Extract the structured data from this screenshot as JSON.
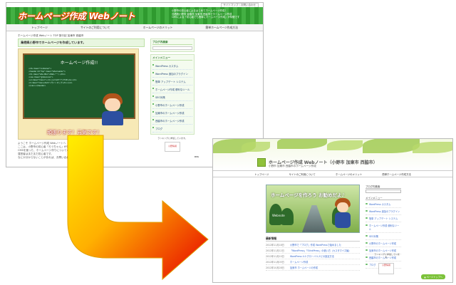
{
  "old": {
    "topbar_link": "サイトマップ｜お問い合わせ",
    "logo": "ホームページ作成 Webノート",
    "header_info": [
      "小野市の初心者によるはじめてホームページ作成！",
      "鳥栖県小野市 姫路市 加東市 西脇市でホームページ作成",
      "CMSによる「初心者でも簡単にホームページ作成」が特徴です"
    ],
    "nav": [
      "トップページ",
      "サイトのご利用について",
      "ホームページのメリット",
      "簡単ホームページ作成方法"
    ],
    "breadcrumb": "ホームページ作成 Webノート TOP 旅行記 加東市 西脇市",
    "main_title": "鳥栖県小野市でホームページを作成しています。",
    "board_title": "ホームページ作成!!",
    "board_code": [
      "<div class=\"container\">",
      "<header id=\"top\" class=\"site-header\">",
      "<h1 class=\"site-title\">Webノート</h1>",
      "<nav class=\"global-nav\">",
      "<ul class=\"menu\"><li><a href=\"/\">TOP</a></li>",
      "<li class=\"menu-item\">サイトマップ</li></ul>",
      "</nav></header>"
    ],
    "slogan": "頑張ります！元気です！",
    "paragraph": [
      "ようこそ ホームページ作成 Webノートへ",
      "ここは、小野市の初心者「ろうちゃん」が作成したホームページです。",
      "CMSを使った、ホームページ作りについての記事などを掲載しています。",
      "運営者はまだまだ初心者です。",
      "なにか分からないことがあれば、お問い合わせからお気軽にどうぞ"
    ],
    "sidebar_search_label": "ブログ内検索",
    "sidebar_menu_head": "メインメニュー",
    "sidebar_items": [
      "WordPress カスタム",
      "WordPress 追加のプラグイン",
      "簡単 アップデート システム",
      "ホームページ作成 便利なツール",
      "SEO対策",
      "小野市のホームページ作成",
      "加東市のホームページ作成",
      "西脇市のホームページ作成",
      "ブログ"
    ],
    "side_note": "ランキングに参加しています。",
    "side_badge": "小野情報",
    "rss": "RSS"
  },
  "new": {
    "site_title": "ホームページ作成 Webノート（小野市 加東市 西脇市）",
    "site_sub": "小野市 加東市 西脇市のホームページ作成",
    "nav": [
      "トップページ",
      "サイトのご利用について",
      "ホームページのメリット",
      "簡単ホームページ作成方法"
    ],
    "banner_title": "ホームページを作ろう お勧めだよ♪",
    "banner_badge": "Webnote",
    "section_title": "最新情報",
    "posts": [
      {
        "date": "2012年11月18日",
        "title": "小野市で「ブログ」作成 WordPressで始めました"
      },
      {
        "date": "2012年11月12日",
        "title": "「WordPress」「StinkPress」の使い方（カスタマイズ編）"
      },
      {
        "date": "2012年11月10日",
        "title": "WordPress 4.0 グローバルナビの設定方法"
      },
      {
        "date": "2012年11月05日",
        "title": "ホームページ作成"
      },
      {
        "date": "2012年10月28日",
        "title": "加東市 ホームページの作成"
      }
    ],
    "sidebar_search_label": "ブログ内検索",
    "sidebar_menu_head": "メインメニュー",
    "sidebar_items": [
      "WordPress カスタム",
      "WordPress 追加のプラグイン",
      "簡単 アップデート システム",
      "ホームページ作成 便利なツール",
      "SEO対策",
      "小野市のホームページ作成",
      "加東市のホームページ作成",
      "西脇市のホームページ作成",
      "ブログ"
    ],
    "side_note": "ランキングに参加しています。",
    "side_badge": "小野情報",
    "pagetop": "▲ ページトップへ"
  },
  "colors": {
    "old_header": "#3aa53a",
    "new_header": "#9cc84a",
    "arrow_top": "#ffee00",
    "arrow_bottom": "#e60000"
  }
}
